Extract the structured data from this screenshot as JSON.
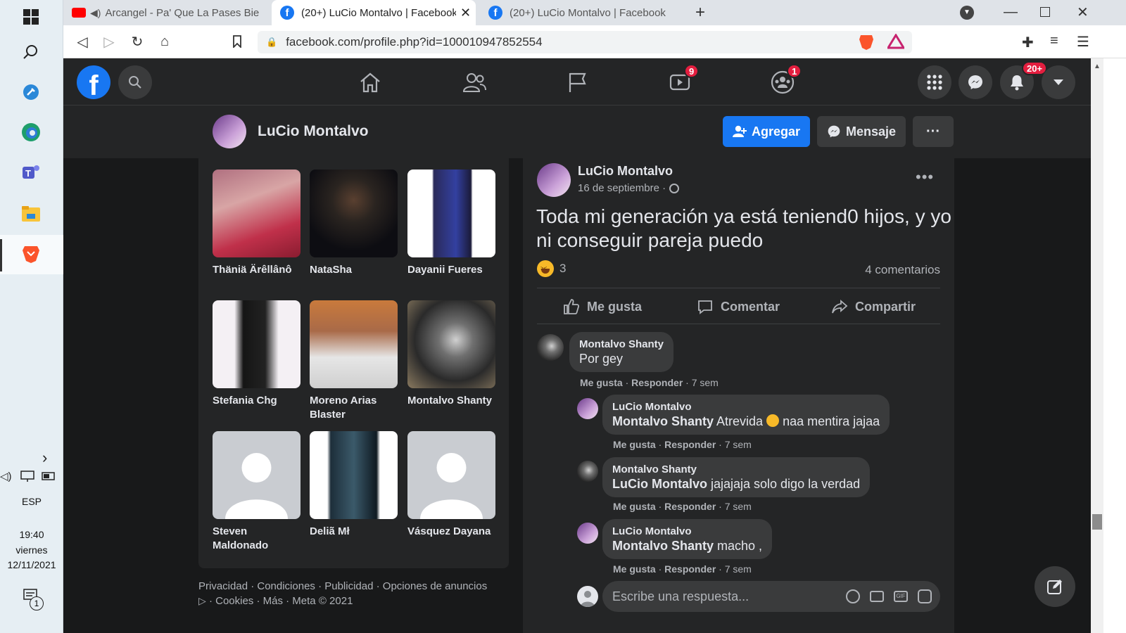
{
  "taskbar": {
    "language": "ESP",
    "time": "19:40",
    "day": "viernes",
    "date": "12/11/2021",
    "notification_count": "1"
  },
  "browser": {
    "tabs": [
      {
        "title": "Arcangel - Pa' Que La Pases Bien [",
        "icon": "youtube-icon"
      },
      {
        "title": "(20+) LuCio Montalvo | Facebook",
        "icon": "facebook-icon"
      },
      {
        "title": "(20+) LuCio Montalvo | Facebook",
        "icon": "facebook-icon"
      }
    ],
    "url": "facebook.com/profile.php?id=100010947852554"
  },
  "fb_header": {
    "watch_badge": "9",
    "groups_badge": "1",
    "notifications_badge": "20+"
  },
  "profile": {
    "name": "LuCio Montalvo",
    "add_label": "Agregar",
    "message_label": "Mensaje",
    "more_label": "···"
  },
  "friends": [
    {
      "name": "Thäniä Ärêllânô"
    },
    {
      "name": "NataSha"
    },
    {
      "name": "Dayanii Fueres"
    },
    {
      "name": "Stefania Chg"
    },
    {
      "name": "Moreno Arias Blaster"
    },
    {
      "name": "Montalvo Shanty"
    },
    {
      "name": "Steven Maldonado"
    },
    {
      "name": "Deliã Mł"
    },
    {
      "name": "Vásquez Dayana"
    }
  ],
  "footer": {
    "line1": "Privacidad · Condiciones · Publicidad · Opciones de anuncios",
    "line2": "· Cookies · Más · Meta © 2021"
  },
  "post": {
    "author": "LuCio Montalvo",
    "date": "16 de septiembre ·",
    "text": "Toda mi generación ya está teniend0 hijos, y yo ni conseguir pareja puedo",
    "reaction_count": "3",
    "comment_count": "4 comentarios",
    "like_label": "Me gusta",
    "comment_label": "Comentar",
    "share_label": "Compartir",
    "reply_placeholder": "Escribe una respuesta..."
  },
  "comments": [
    {
      "author": "Montalvo Shanty",
      "mention": "",
      "text": "Por gey",
      "like": "Me gusta",
      "reply": "Responder",
      "time": "· 7 sem"
    },
    {
      "author": "LuCio Montalvo",
      "mention": "Montalvo Shanty",
      "text": " Atrevida",
      "text2": " naa mentira jajaa",
      "like": "Me gusta",
      "reply": "Responder",
      "time": "· 7 sem"
    },
    {
      "author": "Montalvo Shanty",
      "mention": "LuCio Montalvo",
      "text": " jajajaja solo digo la verdad",
      "like": "Me gusta",
      "reply": "Responder",
      "time": "· 7 sem"
    },
    {
      "author": "LuCio Montalvo",
      "mention": "Montalvo Shanty",
      "text": " macho ,",
      "like": "Me gusta",
      "reply": "Responder",
      "time": "· 7 sem"
    }
  ],
  "colors": {
    "accent": "#1877f2",
    "bg": "#18191a",
    "card": "#242526",
    "badge": "#e41e3f"
  }
}
